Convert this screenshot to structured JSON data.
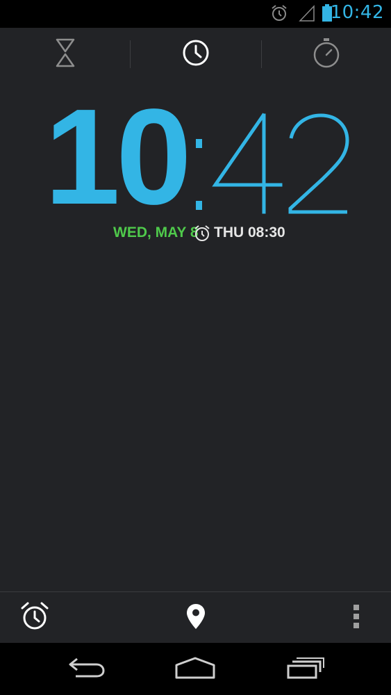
{
  "status_bar": {
    "time": "10:42",
    "icons": [
      "alarm-icon",
      "signal-icon",
      "battery-icon"
    ],
    "accent_color": "#33b5e5"
  },
  "tabs": [
    {
      "name": "timer",
      "icon": "hourglass-icon",
      "selected": false
    },
    {
      "name": "clock",
      "icon": "clock-icon",
      "selected": true
    },
    {
      "name": "stopwatch",
      "icon": "stopwatch-icon",
      "selected": false
    }
  ],
  "clock": {
    "hours": "10",
    "minutes": "42",
    "color": "#33b5e5"
  },
  "date": {
    "date_text": "WED, MAY 8",
    "date_color": "#4fc94b",
    "next_alarm": "THU 08:30"
  },
  "action_bar": {
    "icons": [
      "alarm-clock-icon",
      "location-pin-icon",
      "overflow-menu-icon"
    ]
  },
  "nav_bar": {
    "icons": [
      "back-icon",
      "home-icon",
      "recents-icon"
    ]
  }
}
